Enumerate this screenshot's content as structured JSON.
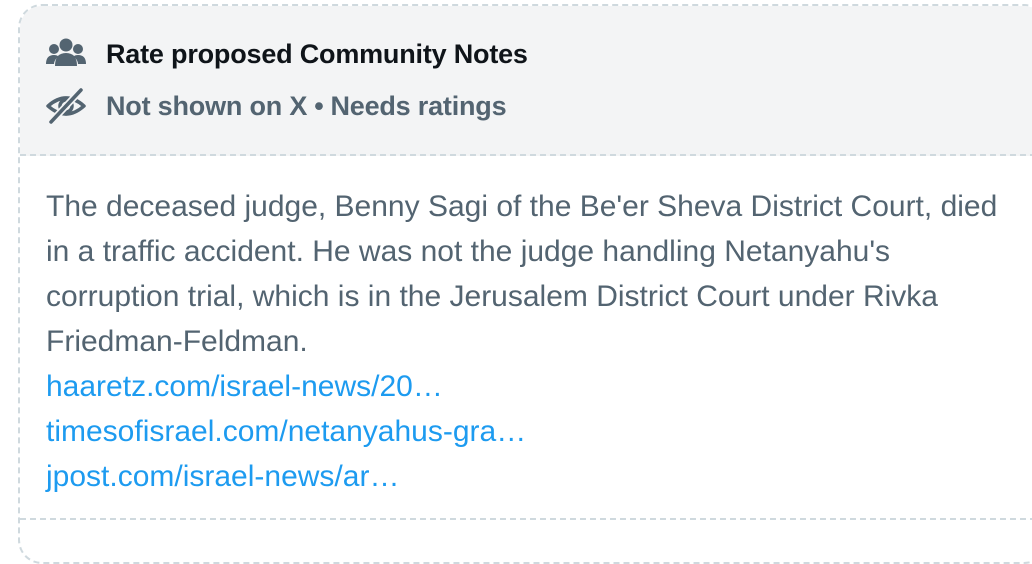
{
  "header": {
    "title": "Rate proposed Community Notes",
    "status": "Not shown on X",
    "separator": "•",
    "status_detail": "Needs ratings",
    "title_icon": "people-group-icon",
    "status_icon": "eye-off-icon"
  },
  "note": {
    "text": "The deceased judge, Benny Sagi of the Be'er Sheva District Court, died in a traffic accident. He was not the judge handling Netanyahu's corruption trial, which is in the Jerusalem District Court under Rivka Friedman-Feldman.",
    "links": [
      "haaretz.com/israel-news/20…",
      "timesofisrael.com/netanyahus-gra…",
      "jpost.com/israel-news/ar…"
    ]
  },
  "colors": {
    "header_bg": "#f3f4f5",
    "title": "#0f1419",
    "muted": "#536471",
    "link": "#1d9bf0",
    "border": "#cfd9de"
  }
}
